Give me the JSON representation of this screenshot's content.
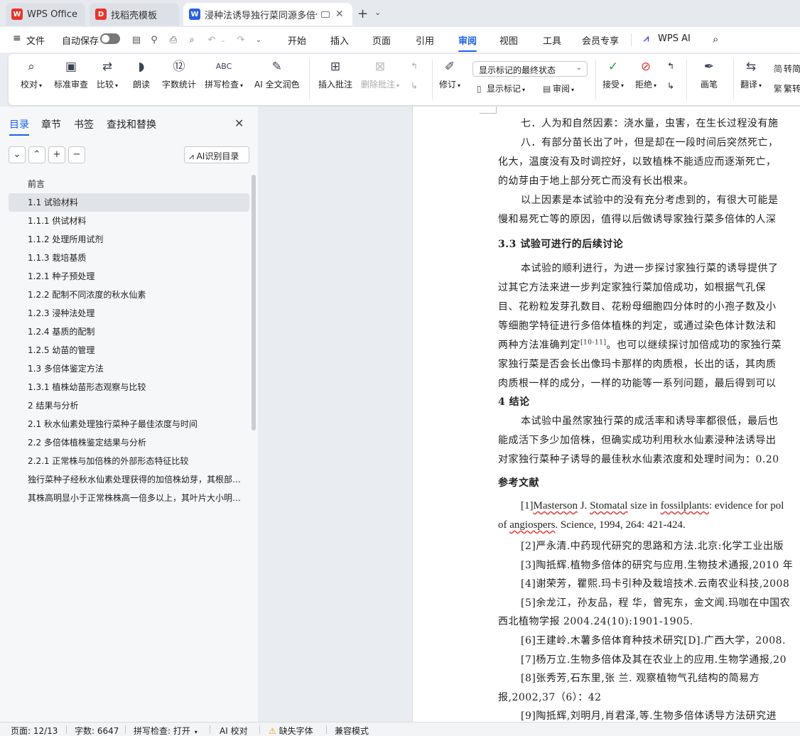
{
  "tabs": [
    {
      "label": "WPS Office",
      "icon": "wps-logo-icon",
      "color": "#e8342c"
    },
    {
      "label": "找稻壳模板",
      "icon": "docer-icon",
      "color": "#e8342c"
    },
    {
      "label": "浸种法诱导独行菜同源多倍体",
      "icon": "word-doc-icon",
      "color": "#2d5fe0",
      "active": true
    }
  ],
  "menu": {
    "file": "文件",
    "autosave": "自动保存",
    "items": [
      "开始",
      "插入",
      "页面",
      "引用",
      "审阅",
      "视图",
      "工具",
      "会员专享"
    ],
    "active": "审阅",
    "wps_ai": "WPS AI"
  },
  "ribbon": {
    "proofread": "校对",
    "standard_review": "标准审查",
    "compare": "比较",
    "read_aloud": "朗读",
    "word_count": "字数统计",
    "spell_check": "拼写检查",
    "ai_polish": "AI 全文润色",
    "insert_comment": "插入批注",
    "delete_comment": "删除批注",
    "revise": "修订",
    "markup_mode": "显示标记的最终状态",
    "show_markup": "显示标记",
    "review": "审阅",
    "accept": "接受",
    "reject": "拒绝",
    "ink": "画笔",
    "translate": "翻译",
    "to_simplified": "转简",
    "to_traditional": "繁转"
  },
  "nav": {
    "tabs": [
      "目录",
      "章节",
      "书签",
      "查找和替换"
    ],
    "ai_toc": "AI识别目录",
    "toc": [
      {
        "text": "前言",
        "level": 0
      },
      {
        "text": "1.1  试验材料",
        "level": 1,
        "selected": true
      },
      {
        "text": "1.1.1  供试材料",
        "level": 1
      },
      {
        "text": "1.1.2  处理所用试剂",
        "level": 1
      },
      {
        "text": "1.1.3  栽培基质",
        "level": 1
      },
      {
        "text": "1.2.1  种子预处理",
        "level": 1
      },
      {
        "text": "1.2.2  配制不同浓度的秋水仙素",
        "level": 1
      },
      {
        "text": "1.2.3  浸种法处理",
        "level": 1
      },
      {
        "text": "1.2.4  基质的配制",
        "level": 1
      },
      {
        "text": "1.2.5  幼苗的管理",
        "level": 1
      },
      {
        "text": "1.3  多倍体鉴定方法",
        "level": 1
      },
      {
        "text": "1.3.1  植株幼苗形态观察与比较",
        "level": 1
      },
      {
        "text": "2 结果与分析",
        "level": 1
      },
      {
        "text": "2.1  秋水仙素处理独行菜种子最佳浓度与时间",
        "level": 1
      },
      {
        "text": "2.2  多倍体植株鉴定结果与分析",
        "level": 1
      },
      {
        "text": "2.2.1  正常株与加倍株的外部形态特征比较",
        "level": 1
      },
      {
        "text": "独行菜种子经秋水仙素处理获得的加倍株幼芽，其根部膨大",
        "level": 0
      },
      {
        "text": "其株高明显小于正常株株高一倍多以上，其叶片大小明显增大",
        "level": 0
      }
    ]
  },
  "doc": {
    "lines": [
      "七．人为和自然因素：浇水量，虫害，在生长过程没有施",
      "八．有部分苗长出了叶，但是却在一段时间后突然死亡，",
      "化大，温度没有及时调控好，以致植株不能适应而逐渐死亡，",
      "的幼芽由于地上部分死亡而没有长出根来。",
      "以上因素是本试验中的没有充分考虑到的，有很大可能是",
      "慢和易死亡等的原因，值得以后做诱导家独行菜多倍体的人深",
      "3.3  试验可进行的后续讨论",
      "本试验的顺利进行，为进一步探讨家独行菜的诱导提供了",
      "过其它方法来进一步判定家独行菜加倍成功，如根据气孔保",
      "目、花粉粒发芽孔数目、花粉母细胞四分体时的小孢子数及小",
      "等细胞学特征进行多倍体植株的判定，或通过染色体计数法和",
      "两种方法准确判定",
      "[10-11]",
      "。也可以继续探讨加倍成功的家独行菜",
      "家独行菜是否会长出像玛卡那样的肉质根，长出的话，其肉质",
      "肉质根一样的成分，一样的功能等一系列问题，最后得到可以",
      "4  结论",
      "本试验中虽然家独行菜的成活率和诱导率都很低，最后也",
      "能成活下多少加倍株，但确实成功利用秋水仙素浸种法诱导出",
      "对家独行菜种子诱导的最佳秋水仙素浓度和处理时间为：0.20",
      "参考文献",
      "[1]",
      "Masterson",
      " J. ",
      "Stomatal",
      " size in ",
      "fossilplants",
      ": evidence for pol",
      "of ",
      "angiospers",
      ". Science, 1994, 264: 421-424.",
      "[2]严永清.中药现代研究的思路和方法.北京:化学工业出版",
      "[3]陶抵辉.植物多倍体的研究与应用.生物技术通报,2010 年",
      "[4]谢荣芳，瞿熙.玛卡引种及栽培技术.云南农业科技,2008",
      "[5]余龙江，孙友品，程  华，曾宪东，金文闻.玛咖在中国农",
      "西北植物学报  2004.24(10):1901-1905.",
      "[6]王建岭.木薯多倍体育种技术研究[D].广西大学，2008.",
      "[7]杨万立.生物多倍体及其在农业上的应用.生物学通报,20",
      "[8]张秀芳,石东里,张  兰. 观察植物气孔结构的简易方",
      "报,2002,37（6）：42",
      "[9]陶抵辉,刘明月,肖君泽,等.生物多倍体诱导方法研究进"
    ]
  },
  "status": {
    "page": "页面: 12/13",
    "words": "字数: 6647",
    "spell": "拼写检查: 打开",
    "ai_check": "AI 校对",
    "missing_font": "缺失字体",
    "compat": "兼容模式"
  },
  "colors": {
    "accent": "#1a62e8",
    "wps_red": "#e8342c",
    "doc_blue": "#2d5fe0"
  }
}
